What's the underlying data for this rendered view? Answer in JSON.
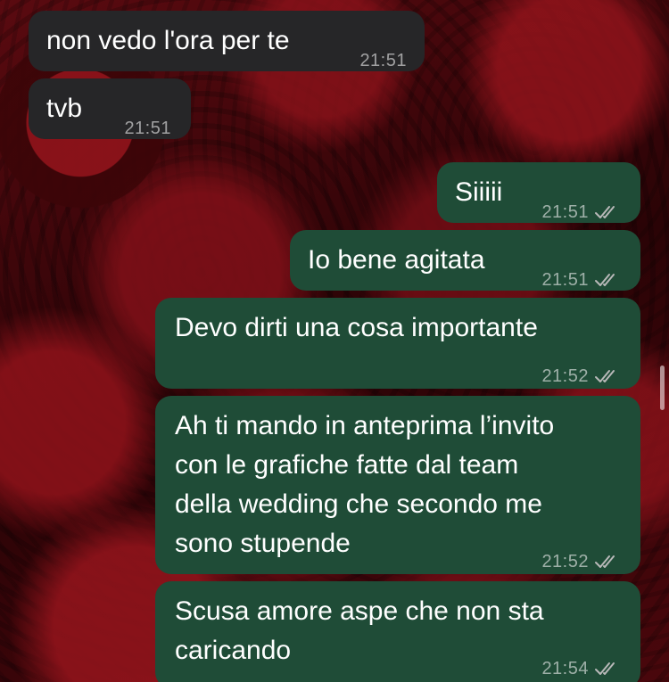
{
  "chat": {
    "messages": [
      {
        "direction": "incoming",
        "lines": [
          "non vedo l'ora per te"
        ],
        "time": "21:51",
        "status": ""
      },
      {
        "direction": "incoming",
        "lines": [
          "tvb"
        ],
        "time": "21:51",
        "status": ""
      },
      {
        "direction": "outgoing",
        "lines": [
          "Siiiii"
        ],
        "time": "21:51",
        "status": "read"
      },
      {
        "direction": "outgoing",
        "lines": [
          "Io bene agitata"
        ],
        "time": "21:51",
        "status": "read"
      },
      {
        "direction": "outgoing",
        "lines": [
          "Devo dirti una cosa importante"
        ],
        "time": "21:52",
        "status": "read"
      },
      {
        "direction": "outgoing",
        "lines": [
          "Ah ti mando in anteprima l’invito",
          "con le grafiche fatte dal team",
          "della wedding che secondo me",
          "sono stupende"
        ],
        "time": "21:52",
        "status": "read"
      },
      {
        "direction": "outgoing",
        "lines": [
          "Scusa amore aspe che non sta",
          "caricando"
        ],
        "time": "21:54",
        "status": "read"
      }
    ]
  },
  "colors": {
    "incoming_bubble": "#262628",
    "outgoing_bubble": "#1f4c37",
    "text": "#ffffff",
    "meta": "#b9b9b9"
  },
  "icons": {
    "read_receipt": "double-check-icon"
  }
}
